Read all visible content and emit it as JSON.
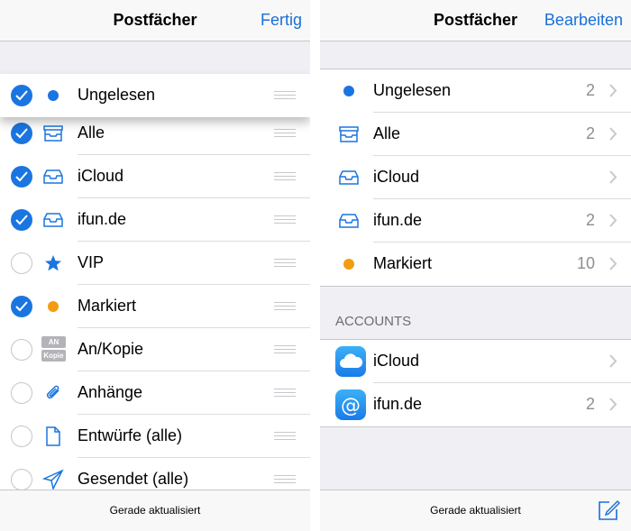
{
  "left": {
    "title": "Postfächer",
    "action": "Fertig",
    "mailboxes": [
      {
        "label": "Ungelesen",
        "checked": true,
        "icon": "unread-dot-icon"
      },
      {
        "label": "Alle",
        "checked": true,
        "icon": "inbox-tray-icon"
      },
      {
        "label": "iCloud",
        "checked": true,
        "icon": "inbox-icon"
      },
      {
        "label": "ifun.de",
        "checked": true,
        "icon": "inbox-icon"
      },
      {
        "label": "VIP",
        "checked": false,
        "icon": "star-icon"
      },
      {
        "label": "Markiert",
        "checked": true,
        "icon": "flag-dot-icon"
      },
      {
        "label": "An/Kopie",
        "checked": false,
        "icon": "to-cc-icon",
        "badge_top": "AN",
        "badge_bottom": "Kopie"
      },
      {
        "label": "Anhänge",
        "checked": false,
        "icon": "paperclip-icon"
      },
      {
        "label": "Entwürfe (alle)",
        "checked": false,
        "icon": "document-icon"
      },
      {
        "label": "Gesendet (alle)",
        "checked": false,
        "icon": "paper-plane-icon"
      }
    ],
    "status": "Gerade aktualisiert"
  },
  "right": {
    "title": "Postfächer",
    "action": "Bearbeiten",
    "mailboxes": [
      {
        "label": "Ungelesen",
        "count": "2",
        "icon": "unread-dot-icon"
      },
      {
        "label": "Alle",
        "count": "2",
        "icon": "inbox-tray-icon"
      },
      {
        "label": "iCloud",
        "count": "",
        "icon": "inbox-icon"
      },
      {
        "label": "ifun.de",
        "count": "2",
        "icon": "inbox-icon"
      },
      {
        "label": "Markiert",
        "count": "10",
        "icon": "flag-dot-icon"
      }
    ],
    "accounts_header": "ACCOUNTS",
    "accounts": [
      {
        "label": "iCloud",
        "count": "",
        "icon": "icloud-icon"
      },
      {
        "label": "ifun.de",
        "count": "2",
        "icon": "at-sign-icon"
      }
    ],
    "status": "Gerade aktualisiert"
  },
  "colors": {
    "accent": "#1a6fd8",
    "unread_dot": "#1a75e0",
    "flag_dot": "#f39c12"
  }
}
